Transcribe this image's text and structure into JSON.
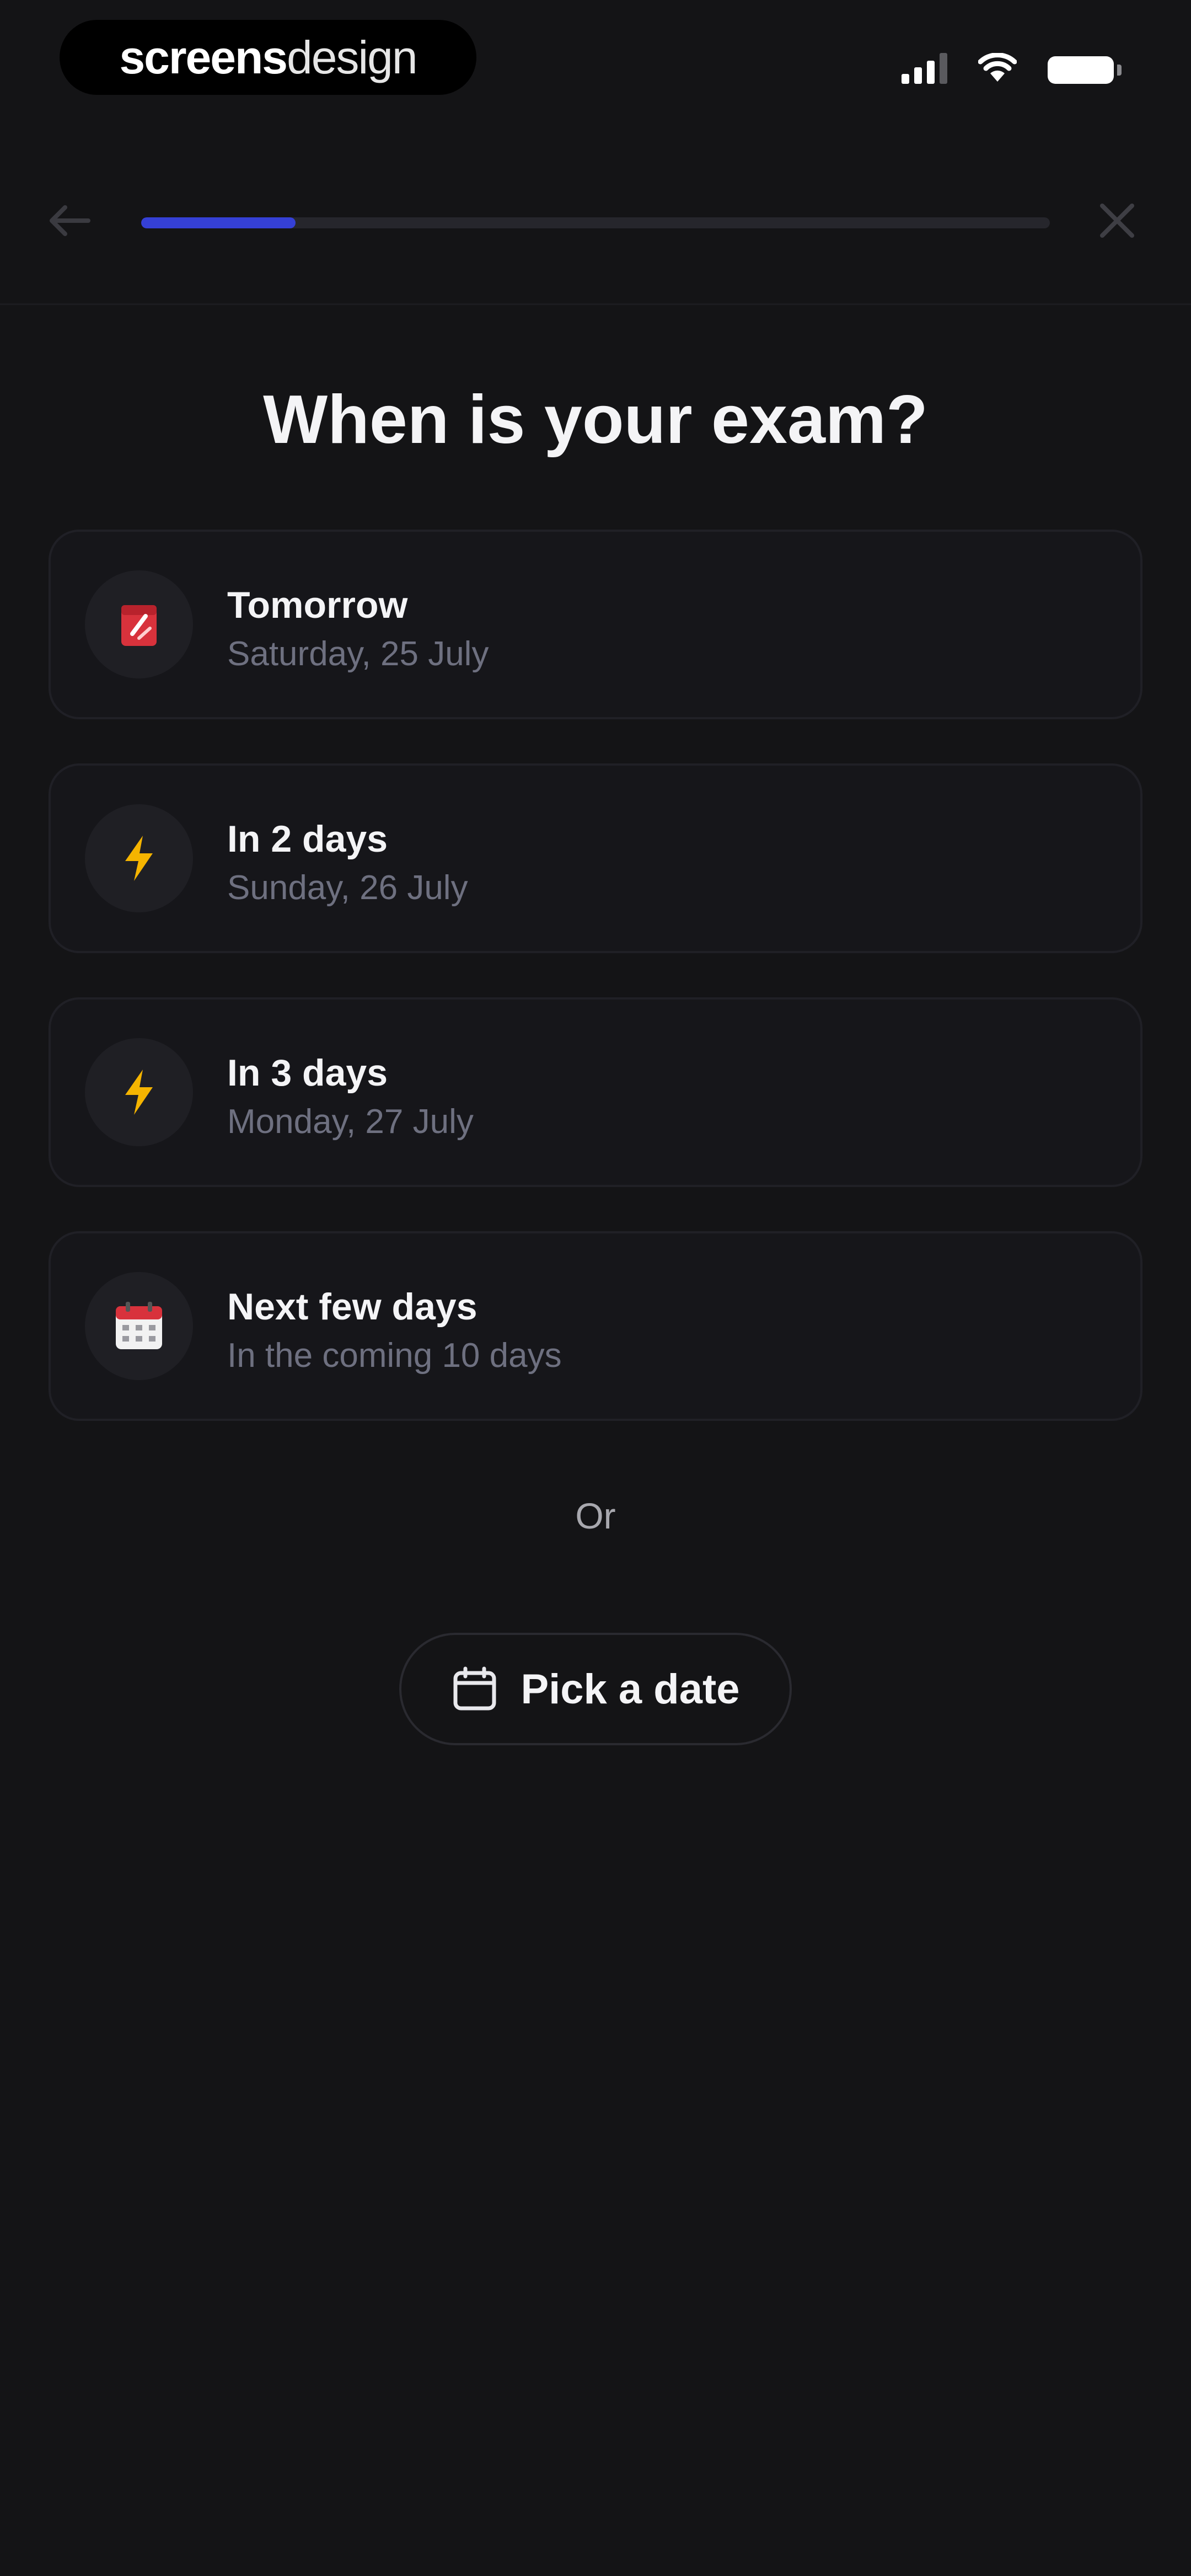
{
  "status_bar": {
    "brand_bold": "screens",
    "brand_light": "design"
  },
  "nav": {
    "progress_fraction": 0.17
  },
  "title": "When is your exam?",
  "options": [
    {
      "icon": "tear-off-calendar-icon",
      "title": "Tomorrow",
      "subtitle": "Saturday, 25 July"
    },
    {
      "icon": "lightning-icon",
      "title": "In 2 days",
      "subtitle": "Sunday, 26 July"
    },
    {
      "icon": "lightning-icon",
      "title": "In 3 days",
      "subtitle": "Monday, 27 July"
    },
    {
      "icon": "calendar-icon",
      "title": "Next few days",
      "subtitle": "In the coming 10 days"
    }
  ],
  "or_label": "Or",
  "pick_date": {
    "icon": "calendar-outline-icon",
    "label": "Pick a date"
  },
  "colors": {
    "background": "#141416",
    "accent": "#3540d6",
    "card_border": "#202026",
    "subtitle": "#6e7080"
  }
}
